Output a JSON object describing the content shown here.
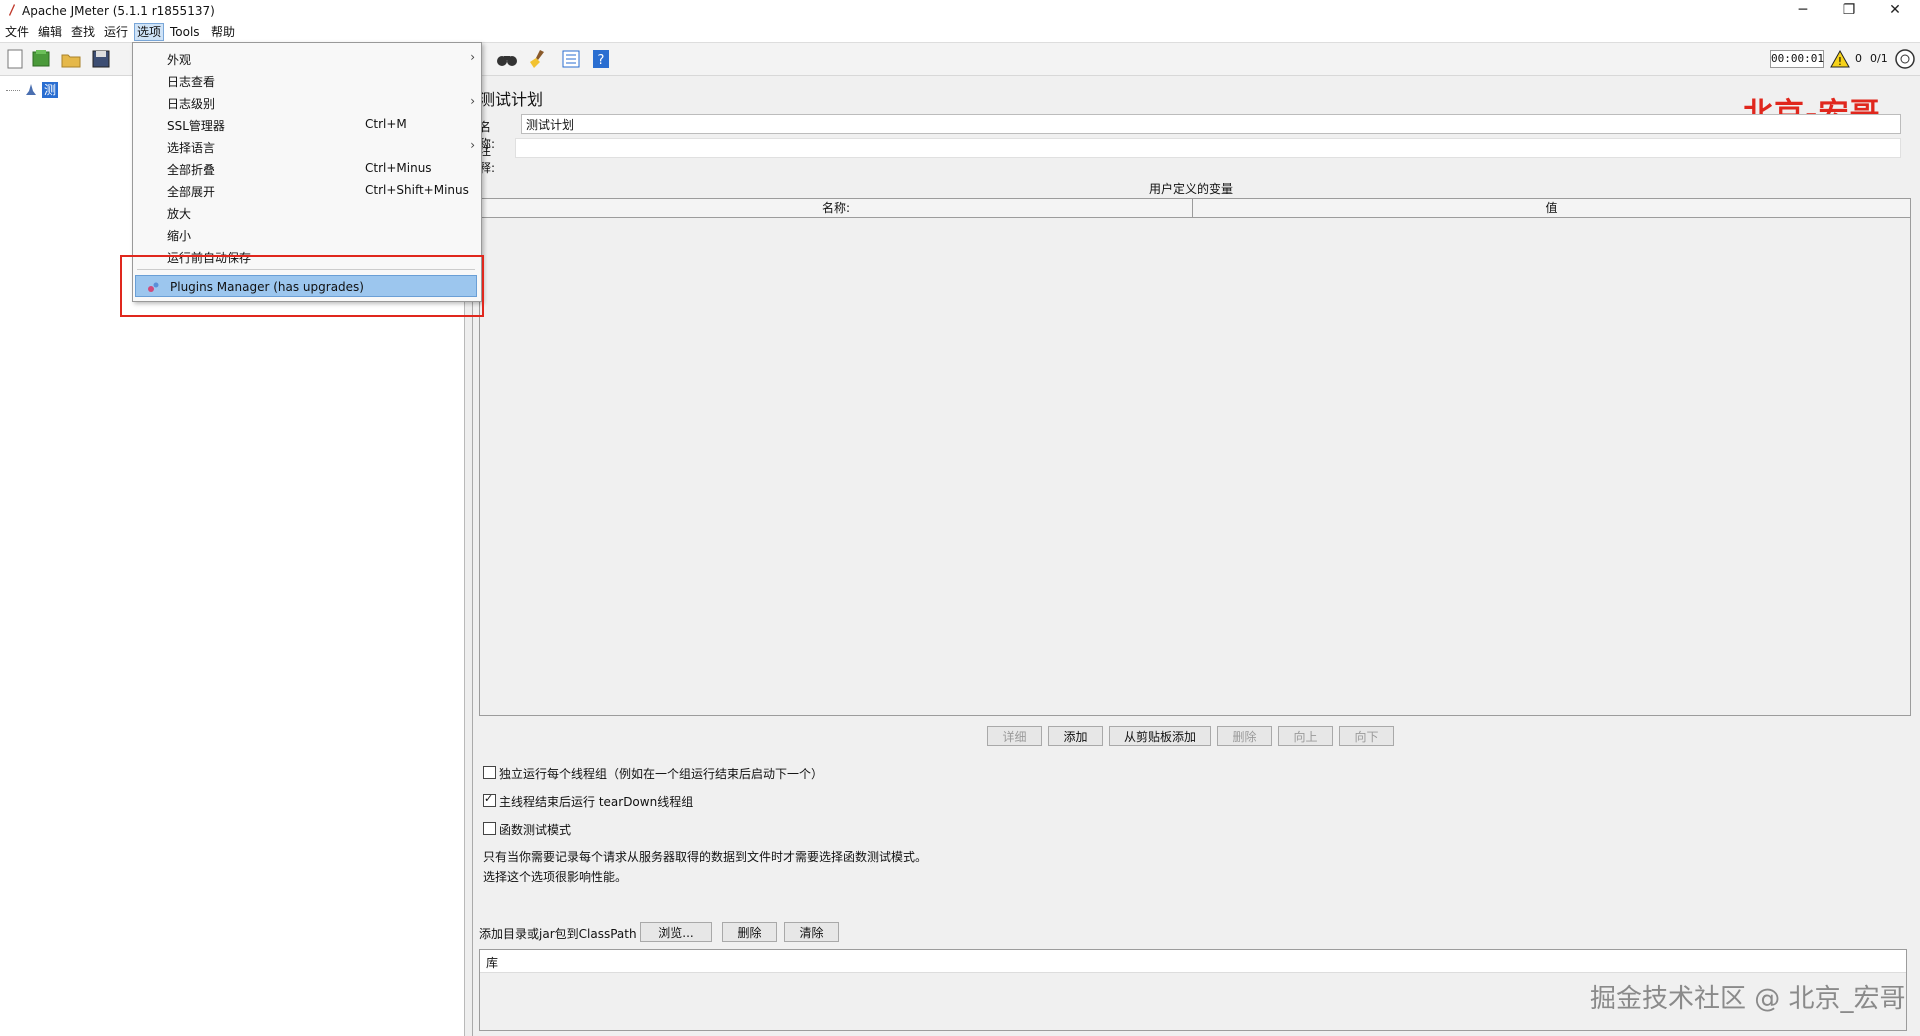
{
  "window": {
    "title": "Apache JMeter (5.1.1 r1855137)",
    "controls": {
      "minimize": "─",
      "restore": "❐",
      "close": "✕"
    }
  },
  "menubar": {
    "items": [
      "文件",
      "编辑",
      "查找",
      "运行",
      "选项",
      "Tools",
      "帮助"
    ],
    "active_index": 4
  },
  "toolbar": {
    "timer": "00:00:01",
    "warning_count": "0",
    "thread_count": "0/1",
    "icons": [
      "new-icon",
      "template-icon",
      "open-icon",
      "save-icon",
      "binoculars-icon",
      "broom-icon",
      "list-icon",
      "help-icon",
      "warning-icon",
      "globe-icon"
    ]
  },
  "tree": {
    "root_label": "测试计划"
  },
  "options_menu": {
    "items": [
      {
        "label": "外观",
        "shortcut": "",
        "submenu": true
      },
      {
        "label": "日志查看",
        "shortcut": "",
        "submenu": false
      },
      {
        "label": "日志级别",
        "shortcut": "",
        "submenu": true
      },
      {
        "label": "SSL管理器",
        "shortcut": "Ctrl+M",
        "submenu": false
      },
      {
        "label": "选择语言",
        "shortcut": "",
        "submenu": true
      },
      {
        "label": "全部折叠",
        "shortcut": "Ctrl+Minus",
        "submenu": false
      },
      {
        "label": "全部展开",
        "shortcut": "Ctrl+Shift+Minus",
        "submenu": false
      },
      {
        "label": "放大",
        "shortcut": "",
        "submenu": false
      },
      {
        "label": "缩小",
        "shortcut": "",
        "submenu": false
      },
      {
        "label": "运行前自动保存",
        "shortcut": "",
        "submenu": false
      }
    ],
    "plugins_item": "Plugins Manager (has upgrades)"
  },
  "main": {
    "panel_title": "测试计划",
    "watermark_top": "北京-宏哥",
    "name_label": "名称:",
    "name_value": "测试计划",
    "comment_label": "注释:",
    "comment_value": "",
    "variables_caption": "用户定义的变量",
    "table_headers": [
      "名称:",
      "值"
    ],
    "buttons": [
      "详细",
      "添加",
      "从剪贴板添加",
      "删除",
      "向上",
      "向下"
    ],
    "checkboxes": [
      {
        "label": "独立运行每个线程组（例如在一个组运行结束后启动下一个）",
        "checked": false
      },
      {
        "label": "主线程结束后运行 tearDown线程组",
        "checked": true
      },
      {
        "label": "函数测试模式",
        "checked": false
      }
    ],
    "note_line1": "只有当你需要记录每个请求从服务器取得的数据到文件时才需要选择函数测试模式。",
    "note_line2": "选择这个选项很影响性能。",
    "classpath_label": "添加目录或jar包到ClassPath",
    "classpath_buttons": [
      "浏览...",
      "删除",
      "清除"
    ],
    "library_header": "库",
    "watermark_bottom": "掘金技术社区 @ 北京_宏哥"
  },
  "colors": {
    "selection": "#2a6ed1",
    "highlight": "#9cc6ee",
    "callout": "#e0271d"
  }
}
